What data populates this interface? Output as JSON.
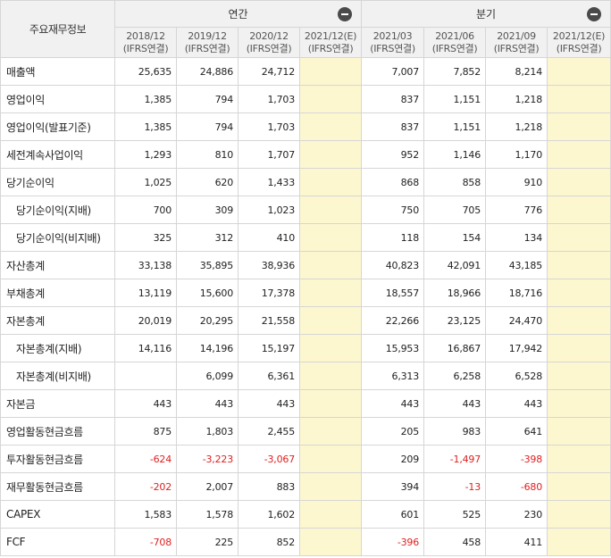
{
  "header": {
    "corner": "주요재무정보",
    "groups": {
      "annual": "연간",
      "quarterly": "분기"
    },
    "periods": [
      {
        "date": "2018/12",
        "basis": "(IFRS연결)"
      },
      {
        "date": "2019/12",
        "basis": "(IFRS연결)"
      },
      {
        "date": "2020/12",
        "basis": "(IFRS연결)"
      },
      {
        "date": "2021/12(E)",
        "basis": "(IFRS연결)"
      },
      {
        "date": "2021/03",
        "basis": "(IFRS연결)"
      },
      {
        "date": "2021/06",
        "basis": "(IFRS연결)"
      },
      {
        "date": "2021/09",
        "basis": "(IFRS연결)"
      },
      {
        "date": "2021/12(E)",
        "basis": "(IFRS연결)"
      }
    ]
  },
  "rows": [
    {
      "label": "매출액",
      "values": [
        "25,635",
        "24,886",
        "24,712",
        "",
        "7,007",
        "7,852",
        "8,214",
        ""
      ]
    },
    {
      "label": "영업이익",
      "values": [
        "1,385",
        "794",
        "1,703",
        "",
        "837",
        "1,151",
        "1,218",
        ""
      ]
    },
    {
      "label": "영업이익(발표기준)",
      "values": [
        "1,385",
        "794",
        "1,703",
        "",
        "837",
        "1,151",
        "1,218",
        ""
      ]
    },
    {
      "label": "세전계속사업이익",
      "values": [
        "1,293",
        "810",
        "1,707",
        "",
        "952",
        "1,146",
        "1,170",
        ""
      ]
    },
    {
      "label": "당기순이익",
      "values": [
        "1,025",
        "620",
        "1,433",
        "",
        "868",
        "858",
        "910",
        ""
      ]
    },
    {
      "label": "당기순이익(지배)",
      "values": [
        "700",
        "309",
        "1,023",
        "",
        "750",
        "705",
        "776",
        ""
      ]
    },
    {
      "label": "당기순이익(비지배)",
      "values": [
        "325",
        "312",
        "410",
        "",
        "118",
        "154",
        "134",
        ""
      ]
    },
    {
      "label": "자산총계",
      "values": [
        "33,138",
        "35,895",
        "38,936",
        "",
        "40,823",
        "42,091",
        "43,185",
        ""
      ]
    },
    {
      "label": "부채총계",
      "values": [
        "13,119",
        "15,600",
        "17,378",
        "",
        "18,557",
        "18,966",
        "18,716",
        ""
      ]
    },
    {
      "label": "자본총계",
      "values": [
        "20,019",
        "20,295",
        "21,558",
        "",
        "22,266",
        "23,125",
        "24,470",
        ""
      ]
    },
    {
      "label": "자본총계(지배)",
      "values": [
        "14,116",
        "14,196",
        "15,197",
        "",
        "15,953",
        "16,867",
        "17,942",
        ""
      ]
    },
    {
      "label": "자본총계(비지배)",
      "values": [
        "",
        "6,099",
        "6,361",
        "",
        "6,313",
        "6,258",
        "6,528",
        ""
      ]
    },
    {
      "label": "자본금",
      "values": [
        "443",
        "443",
        "443",
        "",
        "443",
        "443",
        "443",
        ""
      ]
    },
    {
      "label": "영업활동현금흐름",
      "values": [
        "875",
        "1,803",
        "2,455",
        "",
        "205",
        "983",
        "641",
        ""
      ]
    },
    {
      "label": "투자활동현금흐름",
      "values": [
        "-624",
        "-3,223",
        "-3,067",
        "",
        "209",
        "-1,497",
        "-398",
        ""
      ]
    },
    {
      "label": "재무활동현금흐름",
      "values": [
        "-202",
        "2,007",
        "883",
        "",
        "394",
        "-13",
        "-680",
        ""
      ]
    },
    {
      "label": "CAPEX",
      "values": [
        "1,583",
        "1,578",
        "1,602",
        "",
        "601",
        "525",
        "230",
        ""
      ]
    },
    {
      "label": "FCF",
      "values": [
        "-708",
        "225",
        "852",
        "",
        "-396",
        "458",
        "411",
        ""
      ]
    }
  ],
  "colors": {
    "negative": "#e02020",
    "estimate_bg": "#fdf7cf",
    "header_bg": "#f1f1f1"
  }
}
